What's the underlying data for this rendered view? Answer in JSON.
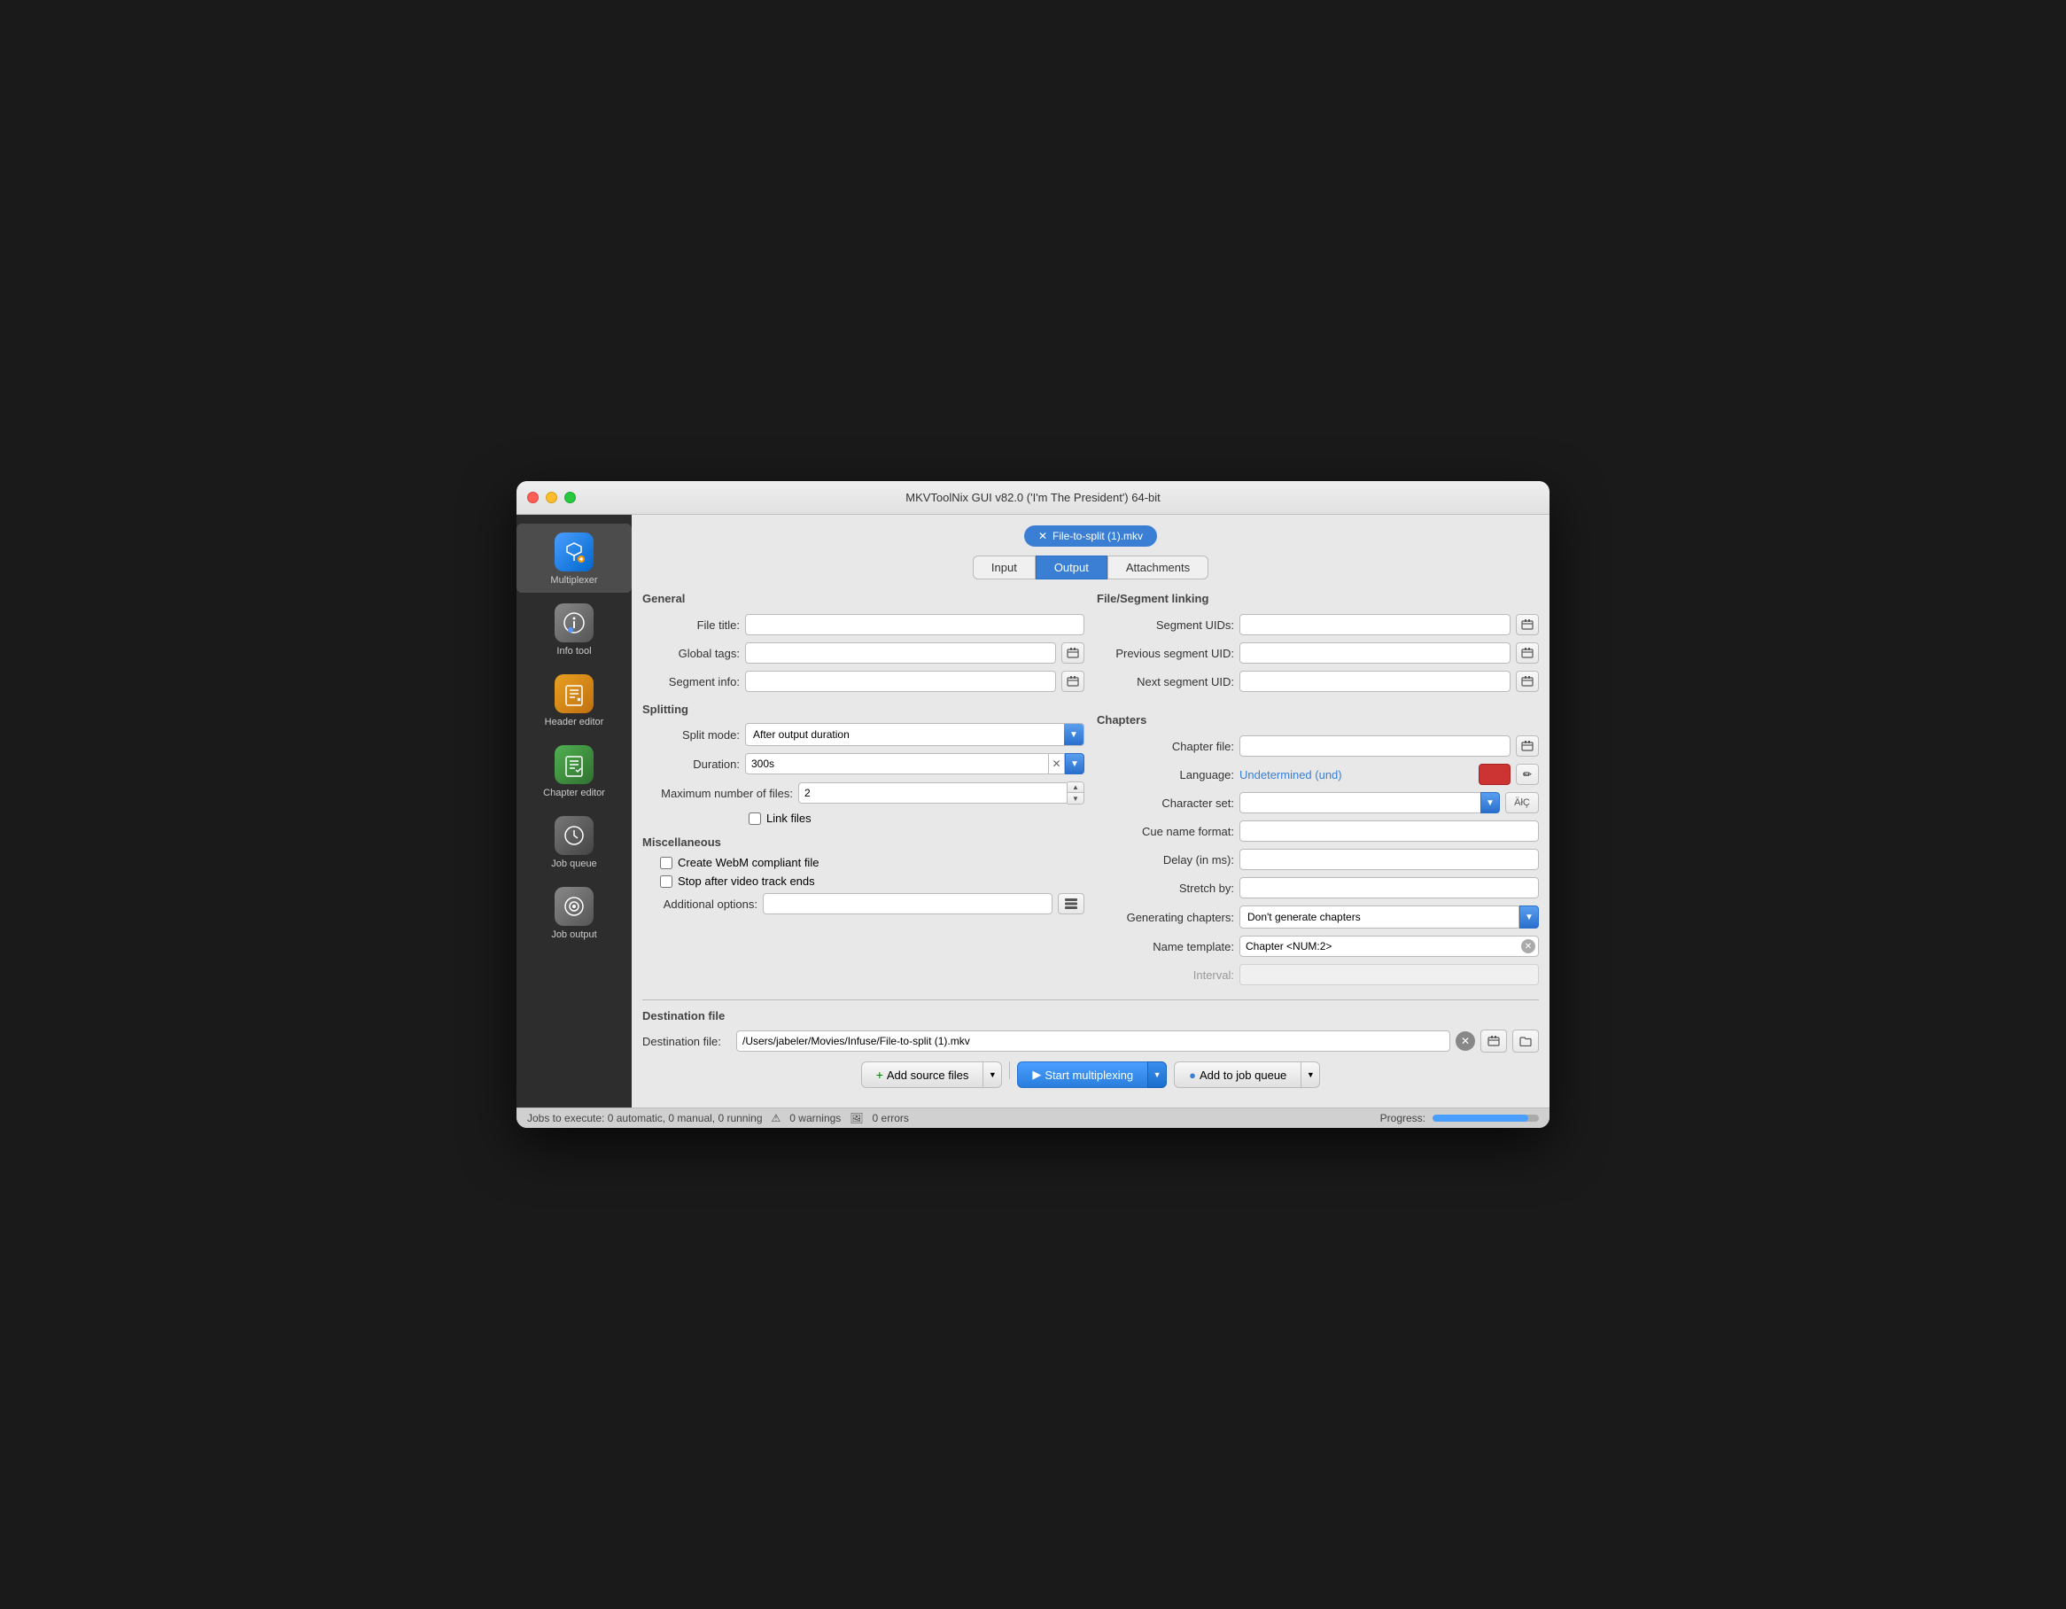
{
  "window": {
    "title": "MKVToolNix GUI v82.0 ('I'm The President') 64-bit"
  },
  "sidebar": {
    "items": [
      {
        "id": "multiplexer",
        "label": "Multiplexer",
        "icon": "⊞"
      },
      {
        "id": "info-tool",
        "label": "Info tool",
        "icon": "🔍"
      },
      {
        "id": "header-editor",
        "label": "Header editor",
        "icon": "✏"
      },
      {
        "id": "chapter-editor",
        "label": "Chapter editor",
        "icon": "✔"
      },
      {
        "id": "job-queue",
        "label": "Job queue",
        "icon": "⚙"
      },
      {
        "id": "job-output",
        "label": "Job output",
        "icon": "⚙"
      }
    ]
  },
  "file_tab": {
    "label": "✕ File-to-split (1).mkv"
  },
  "nav_tabs": {
    "tabs": [
      "Input",
      "Output",
      "Attachments"
    ],
    "active": "Output"
  },
  "general": {
    "section_title": "General",
    "file_title_label": "File title:",
    "global_tags_label": "Global tags:",
    "segment_info_label": "Segment info:"
  },
  "splitting": {
    "section_title": "Splitting",
    "split_mode_label": "Split mode:",
    "split_mode_value": "After output duration",
    "duration_label": "Duration:",
    "duration_value": "300s",
    "max_files_label": "Maximum number of files:",
    "max_files_value": "2",
    "link_files_label": "Link files"
  },
  "miscellaneous": {
    "section_title": "Miscellaneous",
    "create_webm_label": "Create WebM compliant file",
    "stop_after_video_label": "Stop after video track ends",
    "additional_options_label": "Additional options:"
  },
  "file_segment_linking": {
    "section_title": "File/Segment linking",
    "segment_uids_label": "Segment UIDs:",
    "previous_uid_label": "Previous segment UID:",
    "next_uid_label": "Next segment UID:"
  },
  "chapters": {
    "section_title": "Chapters",
    "chapter_file_label": "Chapter file:",
    "language_label": "Language:",
    "language_value": "Undetermined (und)",
    "character_set_label": "Character set:",
    "character_set_btn": "ÄłÇ",
    "cue_name_label": "Cue name format:",
    "delay_label": "Delay (in ms):",
    "stretch_label": "Stretch by:",
    "generating_label": "Generating chapters:",
    "generating_value": "Don't generate chapters",
    "name_template_label": "Name template:",
    "name_template_value": "Chapter <NUM:2>",
    "interval_label": "Interval:"
  },
  "destination": {
    "section_title": "Destination file",
    "label": "Destination file:",
    "value": "/Users/jabeler/Movies/Infuse/File-to-split (1).mkv"
  },
  "action_bar": {
    "add_source": "+ Add source files",
    "start_mux": "▶ Start multiplexing",
    "add_queue": "● Add to job queue"
  },
  "status_bar": {
    "jobs_text": "Jobs to execute:  0 automatic, 0 manual, 0 running",
    "warnings": "0 warnings",
    "errors": "0 errors",
    "progress_label": "Progress:",
    "progress_value": 90
  }
}
